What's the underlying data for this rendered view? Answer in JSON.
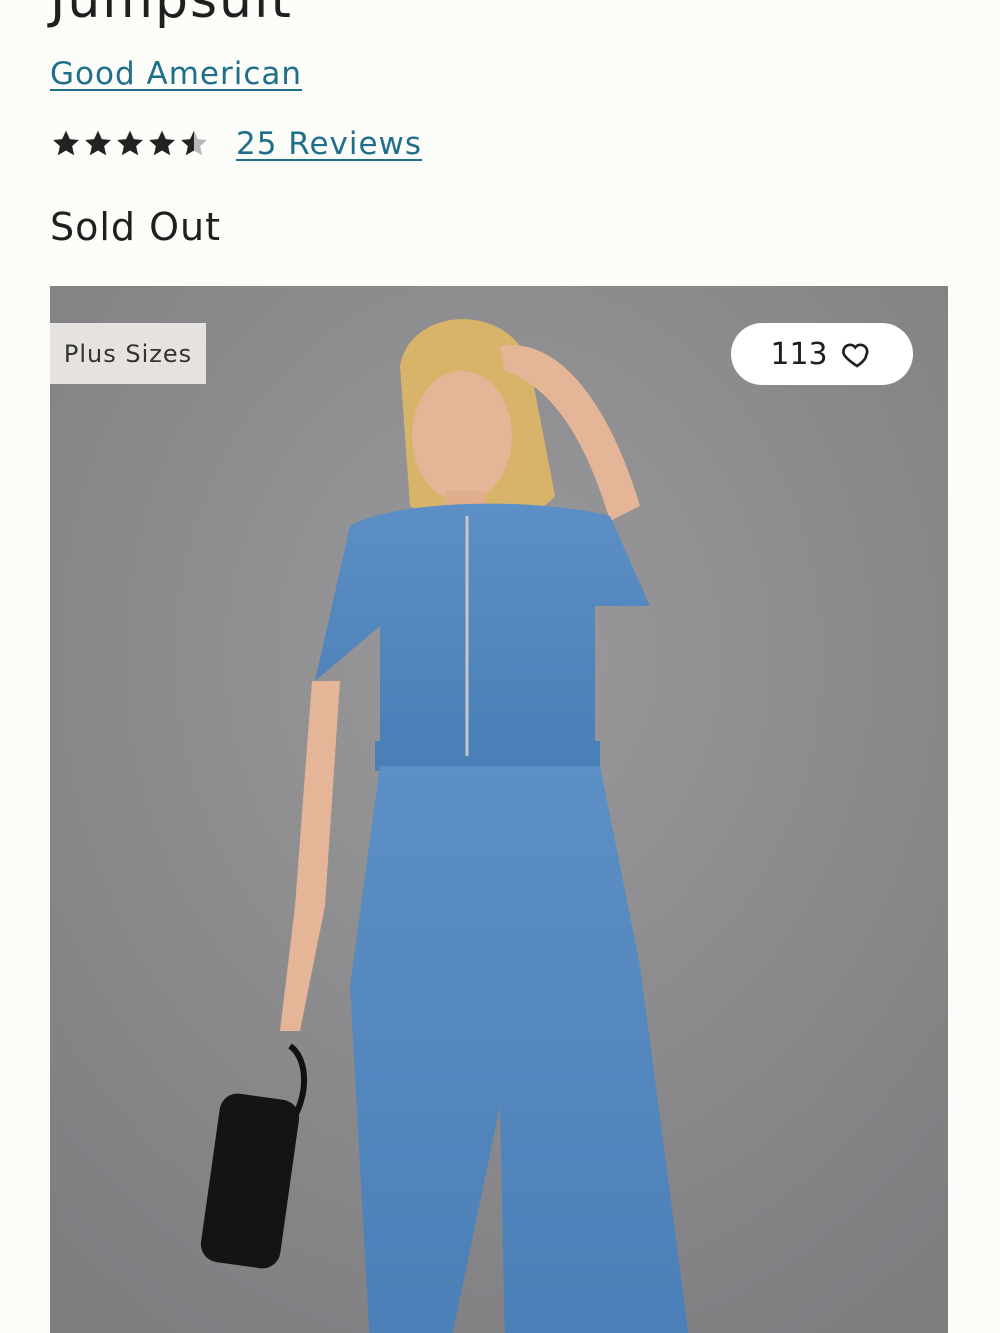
{
  "product": {
    "title": "Jumpsuit",
    "brand": "Good American",
    "rating": 4.5,
    "reviews_label": "25 Reviews",
    "status": "Sold Out"
  },
  "image": {
    "badge": "Plus Sizes",
    "favorite_count": "113",
    "favorite_icon": "heart-outline-icon"
  },
  "colors": {
    "link": "#1f6f8b",
    "text": "#1f1f1f",
    "background": "#fcfcf9",
    "photo_backdrop": "#8d8c8e",
    "denim": "#4f84bd"
  }
}
